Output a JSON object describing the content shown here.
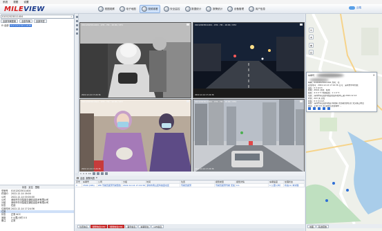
{
  "menu": [
    "系统",
    "视图",
    "设置"
  ],
  "logo": {
    "first": "MILE",
    "second": "VIEW"
  },
  "toolbar": [
    {
      "label": "视图观察",
      "icon": "eye-icon"
    },
    {
      "label": "电子地图",
      "icon": "globe-icon"
    },
    {
      "label": "视频观看",
      "icon": "camera-icon",
      "active": true
    },
    {
      "label": "安全监控",
      "icon": "shield-icon"
    },
    {
      "label": "数据统计",
      "icon": "chart-icon"
    },
    {
      "label": "报警统计",
      "icon": "alarm-icon"
    },
    {
      "label": "设备管理",
      "icon": "device-icon"
    },
    {
      "label": "用户信息",
      "icon": "user-icon"
    }
  ],
  "cloud_label": "云端",
  "left": {
    "search_value": "01012023011404",
    "filters": [
      "全部车辆配置",
      "全部车辆",
      "全部车型"
    ],
    "tree_item": {
      "prefix": "全部",
      "plate": "01012023011406"
    },
    "info_tabs": [
      "状态",
      "定位",
      "里程"
    ],
    "info_rows": [
      {
        "k": "车辆号",
        "v": "01012023011404"
      },
      {
        "k": "终端ID",
        "v": "2022-12-14 16:00"
      },
      {
        "k": "公司",
        "v": "2022-12-14 00:00:00"
      },
      {
        "k": "公司",
        "v": "深圳市华中智能交通信息技术有限公司"
      },
      {
        "k": "分组",
        "v": "深圳市华中智能交通信息技术有限公司"
      },
      {
        "k": "状态",
        "v": "在线"
      },
      {
        "k": "位置时间",
        "v": "2022-12-14 17:24:36"
      },
      {
        "k": "位置",
        "v": "",
        "selected": true
      },
      {
        "k": "状态",
        "v": "正常 ACC"
      },
      {
        "k": "速度",
        "v": "0 公里/小时 0 0"
      },
      {
        "k": "备注",
        "v": "正常"
      }
    ]
  },
  "videos": [
    {
      "caption": "01012023011404 - CH1 - HD - 16:00 / CH1",
      "ts": "2022-12-14 17:24:36"
    },
    {
      "caption": "01012023011404 - CH2 - HD - 16:00 / CH2",
      "ts": "2022-12-14 17:24:36"
    },
    {
      "caption": "01012023011404 - CH3 - HD - 16:00 / CH3",
      "ts": "2022-12-14 17:24:36"
    },
    {
      "caption": "01012023011404 - CH4 - HD - 16:00 / CH4",
      "ts": "2022-12-14 17:24:36"
    }
  ],
  "playbar": [
    "1",
    "4",
    "9",
    "16"
  ],
  "events": {
    "toolbar": [
      "全选",
      "报警列表",
      "▾"
    ],
    "headers": [
      "序号",
      "车辆号",
      "公司",
      "分组",
      "时间",
      "位置",
      "报警类型",
      "报警详情",
      "车辆速度",
      "处理状态"
    ],
    "rows": [
      {
        "cells": [
          "1",
          "1500 (CPA)",
          "ZW 驾驶员疲劳驾驶警告",
          "2022-12-14 17:24:36",
          "深圳市南山区科技园北区",
          "驾驶员疲劳",
          "驾驶员疲劳驾驶 无处理",
          "0.1",
          "1 公里/小时",
          "状态(1) 未处理"
        ],
        "red": false
      }
    ]
  },
  "bottom_tabs": [
    {
      "label": "位置信息",
      "err": false
    },
    {
      "label": "报警信息(18)",
      "err": true
    },
    {
      "label": "报警信息(18)",
      "err": true
    },
    {
      "label": "事件信息",
      "err": false
    },
    {
      "label": "车辆状态",
      "err": false
    },
    {
      "label": "GPS信息",
      "err": false
    }
  ],
  "popup": {
    "title": "车辆号：",
    "lines": [
      "车辆：01012023011404   方向：北",
      "定位时间：2022-12-14 17:24:36 公司：深圳市华中智能",
      "速度：0 0 km/h",
      "终端：ZW01   状态：在线",
      "报警：4 0 0 ℃ 导航报警：1 1 0 ℃",
      "位置：深圳市南山区科技园北区科技中三路 2022-12-14",
      "状态：ACC 关  定位",
      "视频：0 0 0 km/h",
      "报警：深圳市南山区科技园 科技路 天创路交通信息 交叉路口附近",
      "备注：正常 ACC 关 报警信息处理中 ..."
    ]
  },
  "right_tabs": [
    "地图",
    "轨迹回放"
  ],
  "colors": {
    "accent": "#2f6fd6",
    "alarm": "#d93a3a",
    "brand_red": "#d81e1e",
    "brand_blue": "#1b3b8c"
  }
}
